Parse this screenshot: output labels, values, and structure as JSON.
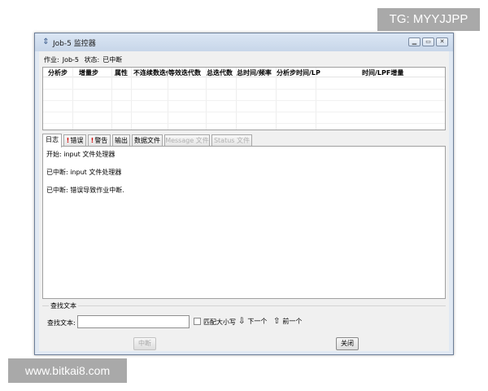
{
  "watermarks": {
    "top": "TG: MYYJJPP",
    "bottom": "www.bitkai8.com"
  },
  "window": {
    "title": "Job-5 监控器",
    "controls": [
      "minimize-icon",
      "restore-icon",
      "close-icon"
    ]
  },
  "status": {
    "job_label": "作业:",
    "job_value": "Job-5",
    "state_label": "状态:",
    "state_value": "已中断"
  },
  "grid": {
    "columns": [
      "分析步",
      "增量步",
      "属性",
      "不连续数迭代",
      "等效迭代数",
      "总迭代数",
      "总时间/频率",
      "分析步时间/LP",
      "时间/LPF增量"
    ]
  },
  "tabs": [
    {
      "label": "日志",
      "active": true,
      "warn": false,
      "disabled": false
    },
    {
      "label": "错误",
      "active": false,
      "warn": true,
      "disabled": false
    },
    {
      "label": "警告",
      "active": false,
      "warn": true,
      "disabled": false
    },
    {
      "label": "输出",
      "active": false,
      "warn": false,
      "disabled": false
    },
    {
      "label": "数据文件",
      "active": false,
      "warn": false,
      "disabled": false
    },
    {
      "label": "Message 文件",
      "active": false,
      "warn": false,
      "disabled": true
    },
    {
      "label": "Status 文件",
      "active": false,
      "warn": false,
      "disabled": true
    }
  ],
  "log": [
    "开始:  input 文件处理器",
    "已中断:  input 文件处理器",
    "已中断:  错误导致作业中断."
  ],
  "find": {
    "group_title": "查找文本",
    "label": "查找文本:",
    "value": "",
    "match_case": "匹配大小写",
    "next": "下一个",
    "prev": "前一个"
  },
  "buttons": {
    "kill": "中断",
    "close": "关闭"
  }
}
